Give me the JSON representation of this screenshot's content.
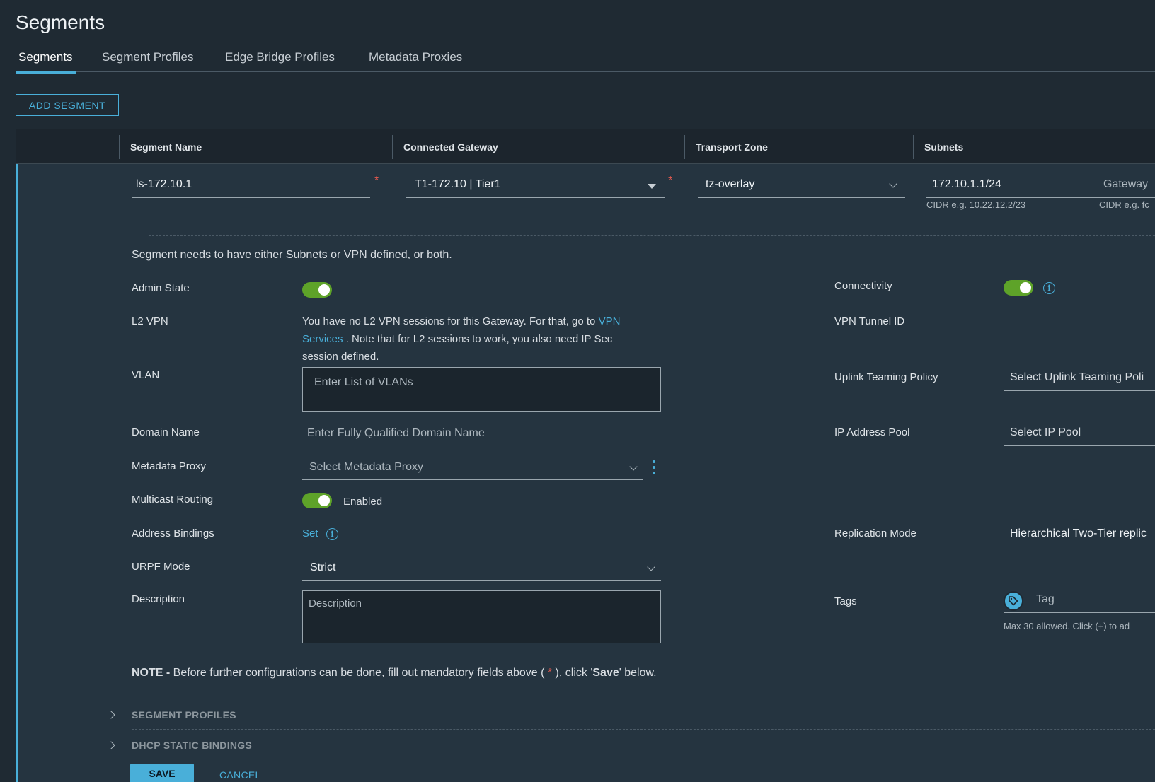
{
  "page": {
    "title": "Segments"
  },
  "tabs": [
    {
      "label": "Segments",
      "active": true
    },
    {
      "label": "Segment Profiles"
    },
    {
      "label": "Edge Bridge Profiles"
    },
    {
      "label": "Metadata Proxies"
    }
  ],
  "toolbar": {
    "add_label": "ADD SEGMENT"
  },
  "table": {
    "columns": [
      "Segment Name",
      "Connected Gateway",
      "Transport Zone",
      "Subnets"
    ]
  },
  "row": {
    "segment_name": "ls-172.10.1",
    "required_mark": "*",
    "connected_gateway": "T1-172.10 | Tier1",
    "transport_zone": "tz-overlay",
    "subnet": "172.10.1.1/24",
    "gateway_label": "Gateway",
    "subnet_hint": "CIDR e.g. 10.22.12.2/23",
    "gateway_hint": "CIDR e.g. fc"
  },
  "form": {
    "notice": "Segment needs to have either Subnets or VPN defined, or both.",
    "admin_state_label": "Admin State",
    "admin_state_on": true,
    "l2vpn_label": "L2 VPN",
    "l2vpn_text_1": "You have no L2 VPN sessions for this Gateway. For that, go to",
    "l2vpn_link_1": "VPN",
    "l2vpn_link_2": "Services",
    "l2vpn_text_2": ". Note that for L2 sessions to work, you also need IP Sec",
    "l2vpn_text_3": "session defined.",
    "vlan_label": "VLAN",
    "vlan_placeholder": "Enter List of VLANs",
    "domain_label": "Domain Name",
    "domain_placeholder": "Enter Fully Qualified Domain Name",
    "metadata_label": "Metadata Proxy",
    "metadata_placeholder": "Select Metadata Proxy",
    "multicast_label": "Multicast Routing",
    "multicast_status": "Enabled",
    "bindings_label": "Address Bindings",
    "bindings_link": "Set",
    "urpf_label": "URPF Mode",
    "urpf_value": "Strict",
    "description_label": "Description",
    "description_placeholder": "Description",
    "connectivity_label": "Connectivity",
    "connectivity_on": true,
    "vpn_tunnel_label": "VPN Tunnel ID",
    "uplink_label": "Uplink Teaming Policy",
    "uplink_placeholder": "Select Uplink Teaming Poli",
    "ippool_label": "IP Address Pool",
    "ippool_placeholder": "Select IP Pool",
    "replication_label": "Replication Mode",
    "replication_value": "Hierarchical Two-Tier replic",
    "tags_label": "Tags",
    "tag_placeholder": "Tag",
    "tags_hint": "Max 30 allowed. Click (+) to ad",
    "note_bold": "NOTE -",
    "note_text_1": " Before further configurations can be done, fill out mandatory fields above ( ",
    "note_star": "*",
    "note_text_2": " ), click '",
    "note_save": "Save",
    "note_text_3": "' below."
  },
  "sections": {
    "segment_profiles": "SEGMENT PROFILES",
    "dhcp_bindings": "DHCP STATIC BINDINGS"
  },
  "actions": {
    "save": "SAVE",
    "cancel": "CANCEL"
  },
  "colors": {
    "accent": "#49afd9",
    "toggle_on": "#5ea329",
    "required": "#e85a4f",
    "background": "#1f2a33"
  }
}
